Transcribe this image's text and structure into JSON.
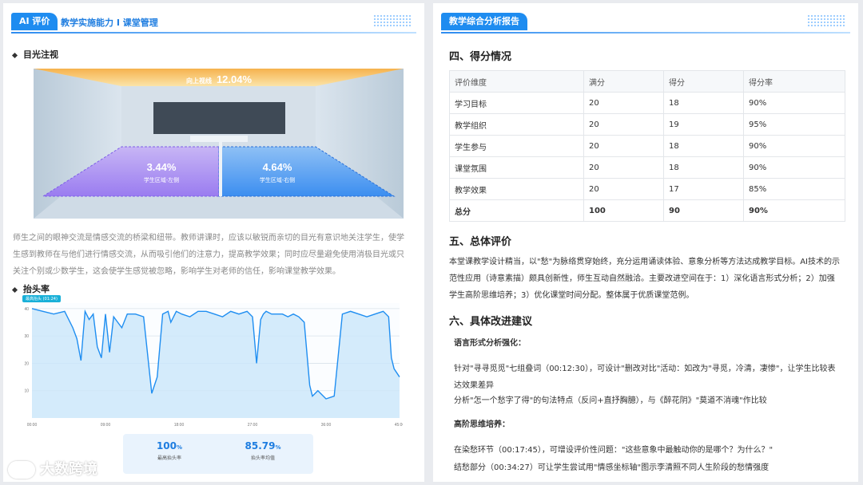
{
  "left": {
    "tag": "AI 评价",
    "title": "教学实施能力 I 课堂管理",
    "s1": "目光注视",
    "room": {
      "front_label": "向上视线",
      "front_value": "12.04%",
      "l_value": "3.44%",
      "l_label": "学生区域-左侧",
      "r_value": "4.64%",
      "r_label": "学生区域-右侧"
    },
    "para": "师生之间的眼神交流是情感交流的桥梁和纽带。教师讲课时，应该以敏锐而亲切的目光有意识地关注学生，使学生感到教师在与他们进行情感交流，从而吸引他们的注意力，提高教学效果；同时应尽量避免使用消极目光或只关注个别或少数学生，这会使学生感觉被忽略，影响学生对老师的信任，影响课堂教学效果。",
    "s2": "抬头率",
    "chart_badge": "最高抬头 (01:24)",
    "stats": [
      {
        "value": "100",
        "unit": "%",
        "label": "最高抬头率"
      },
      {
        "value": "85.79",
        "unit": "%",
        "label": "抬头率均值"
      }
    ]
  },
  "chart_data": {
    "type": "area",
    "title": "",
    "xlabel": "",
    "ylabel": "",
    "x_ticks": [
      "00:00",
      "09:00",
      "18:00",
      "27:00",
      "36:00",
      "45:00"
    ],
    "y_ticks": [
      "10",
      "20",
      "30",
      "40"
    ],
    "xlim": [
      0,
      2700
    ],
    "ylim": [
      0,
      42
    ],
    "grid": true,
    "series": [
      {
        "x": [
          0,
          80,
          160,
          240,
          300,
          330,
          360,
          390,
          420,
          450,
          480,
          510,
          540,
          570,
          600,
          630,
          660,
          700,
          760,
          820,
          880,
          920,
          960,
          1000,
          1020,
          1060,
          1100,
          1160,
          1220,
          1280,
          1340,
          1400,
          1460,
          1520,
          1580,
          1620,
          1650,
          1680,
          1700,
          1720,
          1760,
          1800,
          1840,
          1880,
          1920,
          1960,
          2000,
          2040,
          2060,
          2100,
          2160,
          2220,
          2280,
          2340,
          2400,
          2460,
          2520,
          2580,
          2620,
          2640,
          2660,
          2700
        ],
        "y": [
          40,
          39,
          38,
          39,
          33,
          29,
          21,
          39,
          36,
          38,
          26,
          22,
          38,
          24,
          37,
          35,
          33,
          38,
          38,
          37,
          9,
          15,
          38,
          39,
          35,
          39,
          38,
          37,
          39,
          39,
          38,
          37,
          39,
          38,
          39,
          37,
          20,
          36,
          38,
          39,
          38,
          38,
          38,
          37,
          38,
          37,
          35,
          12,
          8,
          10,
          7,
          8,
          38,
          39,
          38,
          37,
          38,
          39,
          37,
          22,
          18,
          15
        ]
      }
    ],
    "colors": {
      "line": "#1f8ef1",
      "area": "#cbe6fa",
      "low": "#3a5fd9"
    }
  },
  "right": {
    "tag": "教学综合分析报告",
    "h_score": "四、得分情况",
    "table": {
      "headers": [
        "评价维度",
        "满分",
        "得分",
        "得分率"
      ],
      "rows": [
        [
          "学习目标",
          "20",
          "18",
          "90%"
        ],
        [
          "教学组织",
          "20",
          "19",
          "95%"
        ],
        [
          "学生参与",
          "20",
          "18",
          "90%"
        ],
        [
          "课堂氛围",
          "20",
          "18",
          "90%"
        ],
        [
          "教学效果",
          "20",
          "17",
          "85%"
        ],
        [
          "总分",
          "100",
          "90",
          "90%"
        ]
      ]
    },
    "h_eval": "五、总体评价",
    "eval_text": "本堂课教学设计精当，以\"愁\"为脉络贯穿始终，充分运用诵读体验、意象分析等方法达成教学目标。AI技术的示范性应用（诗意素描）颇具创新性，师生互动自然融洽。主要改进空间在于：1）深化语言形式分析；2）加强学生高阶思维培养；3）优化课堂时间分配。整体属于优质课堂范例。",
    "h_suggest": "六、具体改进建议",
    "sub1": "语言形式分析强化：",
    "p1": "针对\"寻寻觅觅\"七组叠词（00:12:30），可设计\"删改对比\"活动：如改为\"寻觅，冷清，凄惨\"，让学生比较表达效果差异",
    "p2": "分析\"怎一个愁字了得\"的句法特点（反问+直抒胸臆），与《醉花阴》\"莫道不消魂\"作比较",
    "sub2": "高阶思维培养：",
    "p3": "在染愁环节（00:17:45），可增设评价性问题：\"这些意象中最触动你的是哪个？为什么？\"",
    "p4": "结愁部分（00:34:27）可让学生尝试用\"情感坐标轴\"图示李清照不同人生阶段的愁情强度"
  },
  "watermark": "大数跨境"
}
